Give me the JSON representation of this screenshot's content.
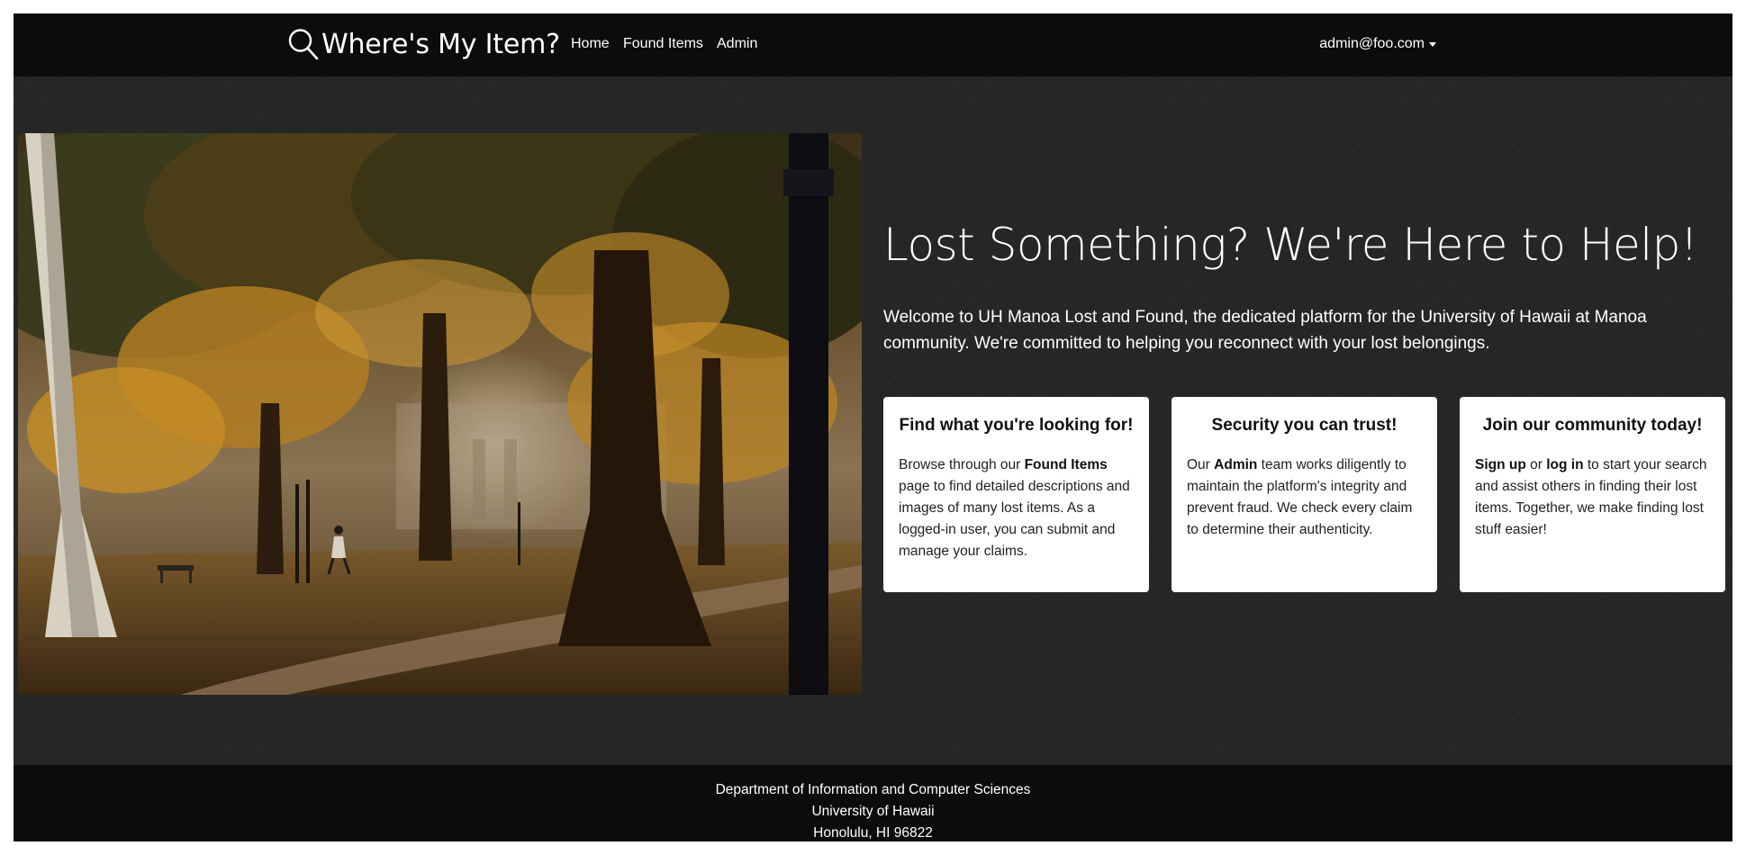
{
  "navbar": {
    "brand": "Where's My Item?",
    "brand_icon": "search-icon",
    "links": [
      "Home",
      "Found Items",
      "Admin"
    ],
    "user": "admin@foo.com",
    "background": "#0c0c0c"
  },
  "hero": {
    "image": "campus-autumn-trees-photo",
    "title": "Lost Something? We're Here to Help!",
    "lead": "Welcome to UH Manoa Lost and Found, the dedicated platform for the University of Hawaii at Manoa community. We're committed to helping you reconnect with your lost belongings."
  },
  "cards": [
    {
      "title": "Find what you're looking for!",
      "text_a": "Browse through our ",
      "text_b": "Found Items",
      "text_c": " page to find detailed descriptions and images of many lost items. As a logged-in user, you can submit and manage your claims."
    },
    {
      "title": "Security you can trust!",
      "text_a": "Our ",
      "text_b": "Admin",
      "text_c": " team works diligently to maintain the platform's integrity and prevent fraud. We check every claim to determine their authenticity."
    },
    {
      "title": "Join our community today!",
      "link_signup": "Sign up",
      "text_or": " or ",
      "link_login": "log in",
      "text_rest": " to start your search and assist others in finding their lost items. Together, we make finding lost stuff easier!"
    }
  ],
  "footer": {
    "line1": "Department of Information and Computer Sciences",
    "line2": "University of Hawaii",
    "line3": "Honolulu, HI 96822"
  },
  "colors": {
    "page_background": "#262626",
    "card_background": "#ffffff",
    "text_light": "#ffffff"
  }
}
